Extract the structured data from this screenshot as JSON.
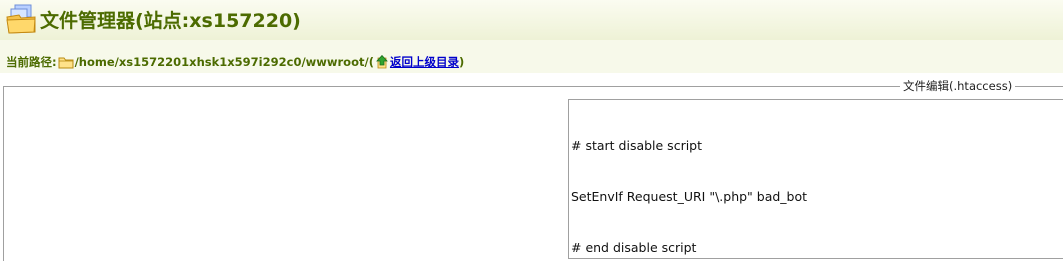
{
  "header": {
    "title": "文件管理器(站点:xs157220)",
    "icon": "file-manager-icon"
  },
  "path": {
    "label": "当前路径:",
    "folder_icon": "folder-icon",
    "value": "/home/xs1572201xhsk1x597i292c0/wwwroot/",
    "open_paren": "(",
    "up_icon": "up-arrow-icon",
    "back_link": "返回上级目录",
    "close_paren": ")"
  },
  "editor": {
    "legend": "文件编辑(.htaccess)",
    "lines": [
      "# start disable script",
      "SetEnvIf Request_URI \"\\.php\" bad_bot",
      "# end disable script"
    ]
  },
  "colors": {
    "title_green": "#4c6b00",
    "link_blue": "#0000cc",
    "header_bg": "#eef2d6"
  }
}
